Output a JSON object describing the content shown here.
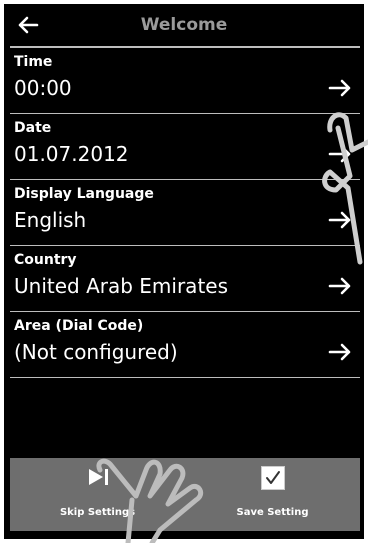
{
  "header": {
    "back_icon": "arrow-left-icon",
    "title": "Welcome"
  },
  "settings": [
    {
      "label": "Time",
      "value": "00:00",
      "icon": "arrow-right-icon"
    },
    {
      "label": "Date",
      "value": "01.07.2012",
      "icon": "arrow-right-icon"
    },
    {
      "label": "Display Language",
      "value": "English",
      "icon": "arrow-right-icon"
    },
    {
      "label": "Country",
      "value": "United Arab Emirates",
      "icon": "arrow-right-icon"
    },
    {
      "label": "Area (Dial Code)",
      "value": "(Not configured)",
      "icon": "arrow-right-icon"
    }
  ],
  "softkeys": {
    "left": {
      "label": "Skip Settings",
      "icon": "skip-icon"
    },
    "right": {
      "label": "Save Setting",
      "icon": "checkbox-checked-icon"
    }
  },
  "colors": {
    "background": "#000000",
    "text": "#ffffff",
    "title": "#9a9a9a",
    "divider": "#bdbdbd",
    "softkey_bar": "#6e6e6e"
  }
}
